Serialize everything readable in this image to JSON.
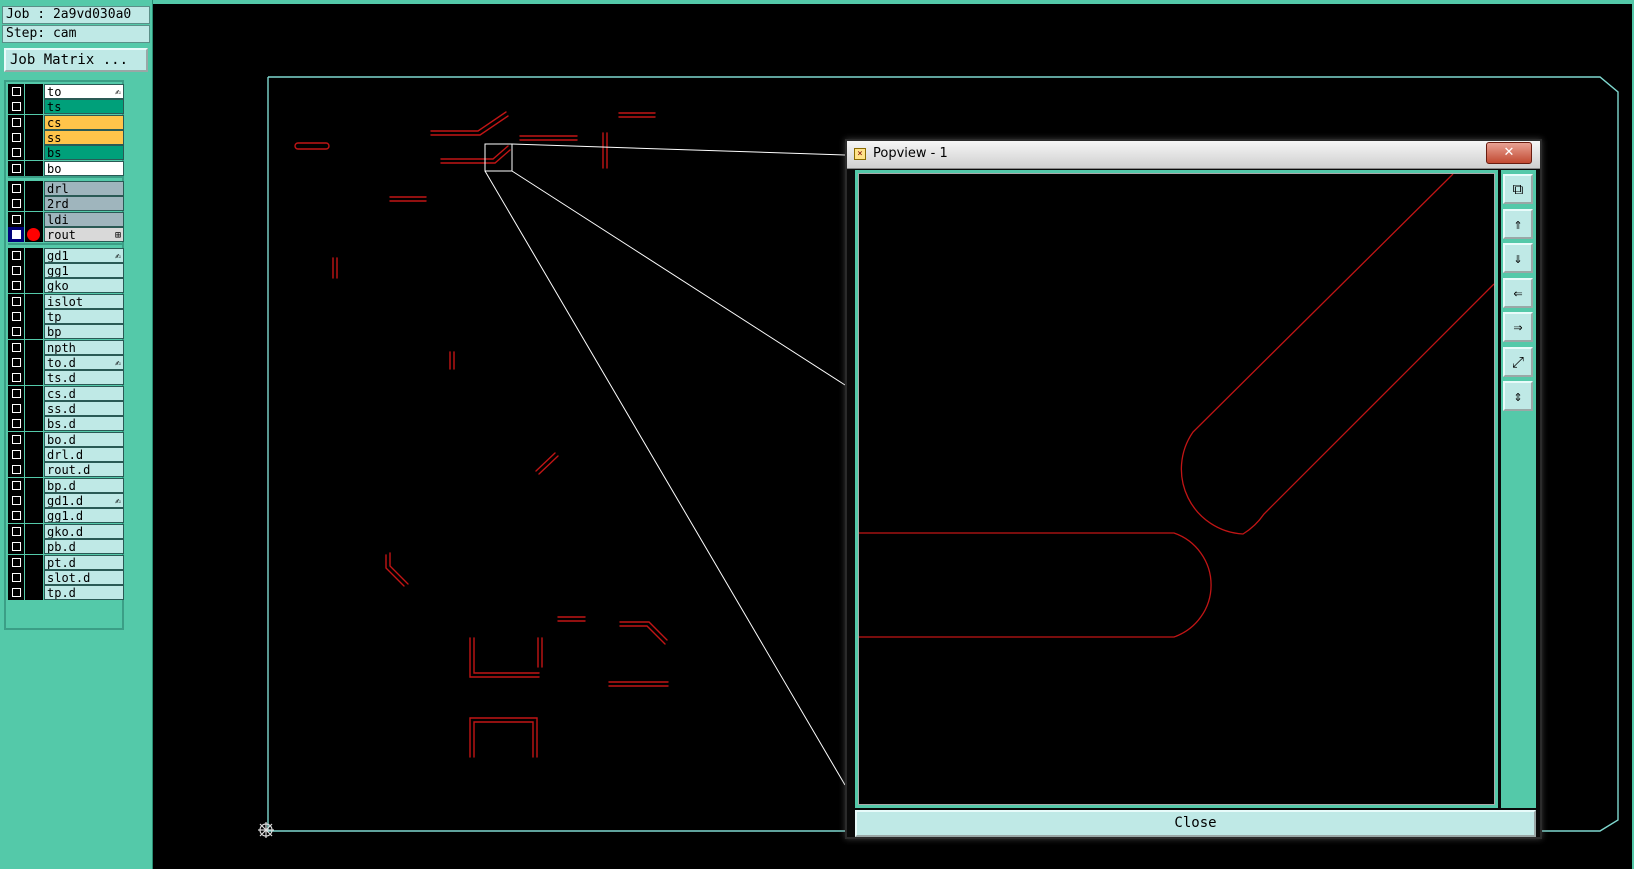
{
  "info": {
    "job": "Job : 2a9vd030a0",
    "step": "Step: cam"
  },
  "job_matrix_label": "Job Matrix ...",
  "layers": [
    {
      "name": "to",
      "bg": "#ffffff",
      "flag": "✍"
    },
    {
      "name": "ts",
      "bg": "#00a07a",
      "flag": ""
    },
    {
      "name": "cs",
      "bg": "#ffc44a",
      "flag": ""
    },
    {
      "name": "ss",
      "bg": "#ffc44a",
      "flag": ""
    },
    {
      "name": "bs",
      "bg": "#00a07a",
      "flag": ""
    },
    {
      "name": "bo",
      "bg": "#ffffff",
      "flag": ""
    },
    {
      "name": "drl",
      "bg": "#9fb5bd",
      "flag": ""
    },
    {
      "name": "2rd",
      "bg": "#9fb5bd",
      "flag": ""
    },
    {
      "name": "ldi",
      "bg": "#9fb5bd",
      "flag": ""
    },
    {
      "name": "rout",
      "bg": "#d9d9d9",
      "flag": "⊞",
      "active": true
    },
    {
      "name": "gd1",
      "bg": "#bfe9e6",
      "flag": "✍"
    },
    {
      "name": "gg1",
      "bg": "#bfe9e6",
      "flag": ""
    },
    {
      "name": "gko",
      "bg": "#bfe9e6",
      "flag": ""
    },
    {
      "name": "islot",
      "bg": "#bfe9e6",
      "flag": ""
    },
    {
      "name": "tp",
      "bg": "#bfe9e6",
      "flag": ""
    },
    {
      "name": "bp",
      "bg": "#bfe9e6",
      "flag": ""
    },
    {
      "name": "npth",
      "bg": "#bfe9e6",
      "flag": ""
    },
    {
      "name": "to.d",
      "bg": "#bfe9e6",
      "flag": "✍"
    },
    {
      "name": "ts.d",
      "bg": "#bfe9e6",
      "flag": ""
    },
    {
      "name": "cs.d",
      "bg": "#bfe9e6",
      "flag": ""
    },
    {
      "name": "ss.d",
      "bg": "#bfe9e6",
      "flag": ""
    },
    {
      "name": "bs.d",
      "bg": "#bfe9e6",
      "flag": ""
    },
    {
      "name": "bo.d",
      "bg": "#bfe9e6",
      "flag": ""
    },
    {
      "name": "drl.d",
      "bg": "#bfe9e6",
      "flag": ""
    },
    {
      "name": "rout.d",
      "bg": "#bfe9e6",
      "flag": ""
    },
    {
      "name": "bp.d",
      "bg": "#bfe9e6",
      "flag": ""
    },
    {
      "name": "gd1.d",
      "bg": "#bfe9e6",
      "flag": "✍"
    },
    {
      "name": "gg1.d",
      "bg": "#bfe9e6",
      "flag": ""
    },
    {
      "name": "gko.d",
      "bg": "#bfe9e6",
      "flag": ""
    },
    {
      "name": "pb.d",
      "bg": "#bfe9e6",
      "flag": ""
    },
    {
      "name": "pt.d",
      "bg": "#bfe9e6",
      "flag": ""
    },
    {
      "name": "slot.d",
      "bg": "#bfe9e6",
      "flag": ""
    },
    {
      "name": "tp.d",
      "bg": "#bfe9e6",
      "flag": ""
    }
  ],
  "popview": {
    "title": "Popview - 1",
    "close_x": "✕",
    "close_label": "Close",
    "tools": [
      {
        "icon": "zoom-window-icon",
        "glyph": "⧉"
      },
      {
        "icon": "pan-up-icon",
        "glyph": "⇑"
      },
      {
        "icon": "pan-down-icon",
        "glyph": "⇓"
      },
      {
        "icon": "pan-left-icon",
        "glyph": "⇐"
      },
      {
        "icon": "pan-right-icon",
        "glyph": "⇒"
      },
      {
        "icon": "zoom-fit-icon",
        "glyph": "⤢"
      },
      {
        "icon": "zoom-home-icon",
        "glyph": "⇕"
      }
    ]
  },
  "colors": {
    "panel": "#54c9a9",
    "rout_line": "#c11515",
    "outline": "#7fd8cf",
    "zoom_lines": "#ffffff"
  }
}
